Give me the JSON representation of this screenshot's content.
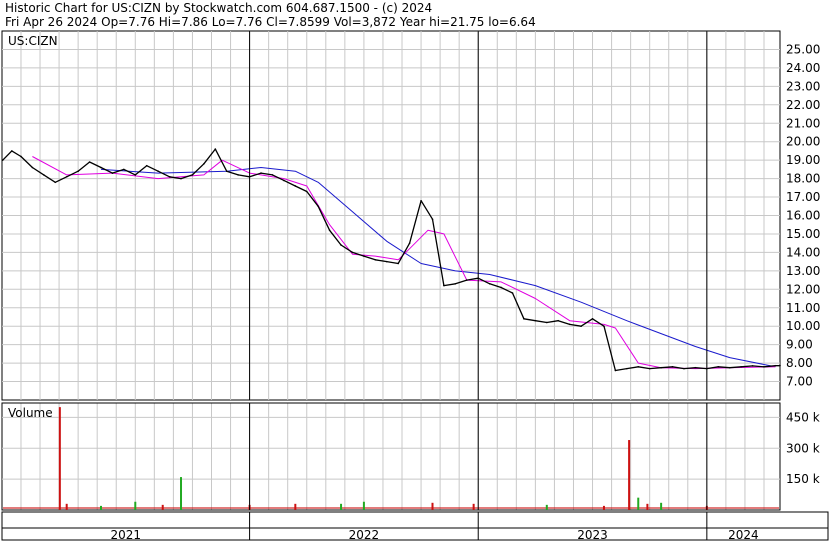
{
  "header": {
    "line1": "Historic Chart for US:CIZN by Stockwatch.com 604.687.1500 - (c) 2024",
    "line2": "Fri Apr 26 2024   Op=7.76  Hi=7.86  Lo=7.76  Cl=7.8599  Vol=3,872  Year hi=21.75  lo=6.64"
  },
  "colors": {
    "price": "#000000",
    "ma_short": "#e000e0",
    "ma_long": "#1a1acc",
    "volume_up": "#22aa22",
    "volume_down": "#cc1111",
    "grid": "#c8c8c8",
    "border": "#000000"
  },
  "chart_data": [
    {
      "type": "line",
      "panel": "price",
      "label": "US:CIZN",
      "ylim": [
        6,
        26
      ],
      "yticks": [
        "25.00",
        "24.00",
        "23.00",
        "22.00",
        "21.00",
        "20.00",
        "19.00",
        "18.00",
        "17.00",
        "16.00",
        "15.00",
        "14.00",
        "13.00",
        "12.00",
        "11.00",
        "10.00",
        "9.00",
        "8.00",
        "7.00"
      ],
      "ytick_values": [
        25,
        24,
        23,
        22,
        21,
        20,
        19,
        18,
        17,
        16,
        15,
        14,
        13,
        12,
        11,
        10,
        9,
        8,
        7
      ],
      "grid": true,
      "x_range": [
        2020.917,
        2024.32
      ],
      "x_labels": [
        "2021",
        "2022",
        "2023",
        "2024"
      ],
      "x_boundaries": [
        2021.0,
        2022.0,
        2023.0,
        2024.0
      ],
      "series": [
        {
          "role": "close",
          "x": [
            2020.92,
            2020.96,
            2021.0,
            2021.05,
            2021.1,
            2021.15,
            2021.2,
            2021.25,
            2021.3,
            2021.35,
            2021.4,
            2021.45,
            2021.5,
            2021.55,
            2021.6,
            2021.65,
            2021.7,
            2021.75,
            2021.8,
            2021.85,
            2021.9,
            2021.95,
            2022.0,
            2022.05,
            2022.1,
            2022.15,
            2022.2,
            2022.25,
            2022.3,
            2022.35,
            2022.4,
            2022.45,
            2022.5,
            2022.55,
            2022.6,
            2022.65,
            2022.7,
            2022.75,
            2022.8,
            2022.85,
            2022.9,
            2022.95,
            2023.0,
            2023.05,
            2023.1,
            2023.15,
            2023.2,
            2023.25,
            2023.3,
            2023.35,
            2023.4,
            2023.45,
            2023.5,
            2023.55,
            2023.6,
            2023.65,
            2023.7,
            2023.75,
            2023.8,
            2023.85,
            2023.9,
            2023.95,
            2024.0,
            2024.05,
            2024.1,
            2024.15,
            2024.2,
            2024.25,
            2024.3,
            2024.32
          ],
          "y": [
            19.0,
            19.5,
            19.2,
            18.6,
            18.2,
            17.8,
            18.1,
            18.4,
            18.9,
            18.6,
            18.3,
            18.5,
            18.2,
            18.7,
            18.4,
            18.1,
            18.0,
            18.2,
            18.8,
            19.6,
            18.4,
            18.2,
            18.1,
            18.3,
            18.2,
            17.9,
            17.6,
            17.3,
            16.5,
            15.2,
            14.4,
            14.0,
            13.8,
            13.6,
            13.5,
            13.4,
            14.5,
            16.8,
            15.8,
            12.2,
            12.3,
            12.5,
            12.6,
            12.3,
            12.1,
            11.8,
            10.4,
            10.3,
            10.2,
            10.3,
            10.1,
            10.0,
            10.4,
            10.0,
            7.6,
            7.7,
            7.8,
            7.7,
            7.75,
            7.8,
            7.7,
            7.75,
            7.7,
            7.8,
            7.75,
            7.8,
            7.85,
            7.8,
            7.86,
            7.8599
          ]
        },
        {
          "role": "ma_short",
          "x": [
            2021.05,
            2021.2,
            2021.4,
            2021.6,
            2021.8,
            2021.88,
            2022.0,
            2022.15,
            2022.25,
            2022.35,
            2022.45,
            2022.55,
            2022.65,
            2022.7,
            2022.78,
            2022.85,
            2022.95,
            2023.1,
            2023.25,
            2023.4,
            2023.55,
            2023.6,
            2023.7,
            2023.8,
            2023.95,
            2024.1,
            2024.3
          ],
          "y": [
            19.2,
            18.2,
            18.3,
            18.0,
            18.2,
            19.0,
            18.3,
            18.0,
            17.6,
            15.5,
            13.9,
            13.8,
            13.6,
            14.2,
            15.2,
            15.0,
            12.5,
            12.4,
            11.5,
            10.3,
            10.1,
            9.9,
            8.0,
            7.75,
            7.7,
            7.75,
            7.8
          ]
        },
        {
          "role": "ma_long",
          "x": [
            2021.35,
            2021.6,
            2021.9,
            2022.05,
            2022.2,
            2022.3,
            2022.45,
            2022.6,
            2022.75,
            2022.9,
            2023.05,
            2023.25,
            2023.45,
            2023.65,
            2023.8,
            2023.95,
            2024.1,
            2024.3
          ],
          "y": [
            18.5,
            18.3,
            18.4,
            18.6,
            18.4,
            17.8,
            16.2,
            14.6,
            13.4,
            13.0,
            12.8,
            12.2,
            11.3,
            10.3,
            9.6,
            8.9,
            8.3,
            7.8
          ]
        }
      ]
    },
    {
      "type": "bar",
      "panel": "volume",
      "label": "Volume",
      "ylim": [
        0,
        520
      ],
      "yticks": [
        "450 k",
        "300 k",
        "150 k"
      ],
      "ytick_values": [
        450,
        300,
        150
      ],
      "grid": true,
      "x": [
        2021.17,
        2021.2,
        2021.35,
        2021.5,
        2021.62,
        2021.7,
        2022.0,
        2022.2,
        2022.4,
        2022.5,
        2022.8,
        2022.98,
        2023.3,
        2023.55,
        2023.66,
        2023.7,
        2023.74,
        2023.8,
        2024.0
      ],
      "values": [
        500,
        30,
        20,
        40,
        25,
        160,
        25,
        30,
        30,
        40,
        35,
        30,
        25,
        20,
        340,
        60,
        30,
        35,
        20
      ],
      "direction": [
        "down",
        "down",
        "up",
        "up",
        "down",
        "up",
        "down",
        "down",
        "up",
        "up",
        "down",
        "down",
        "up",
        "down",
        "down",
        "up",
        "down",
        "up",
        "down"
      ]
    }
  ]
}
